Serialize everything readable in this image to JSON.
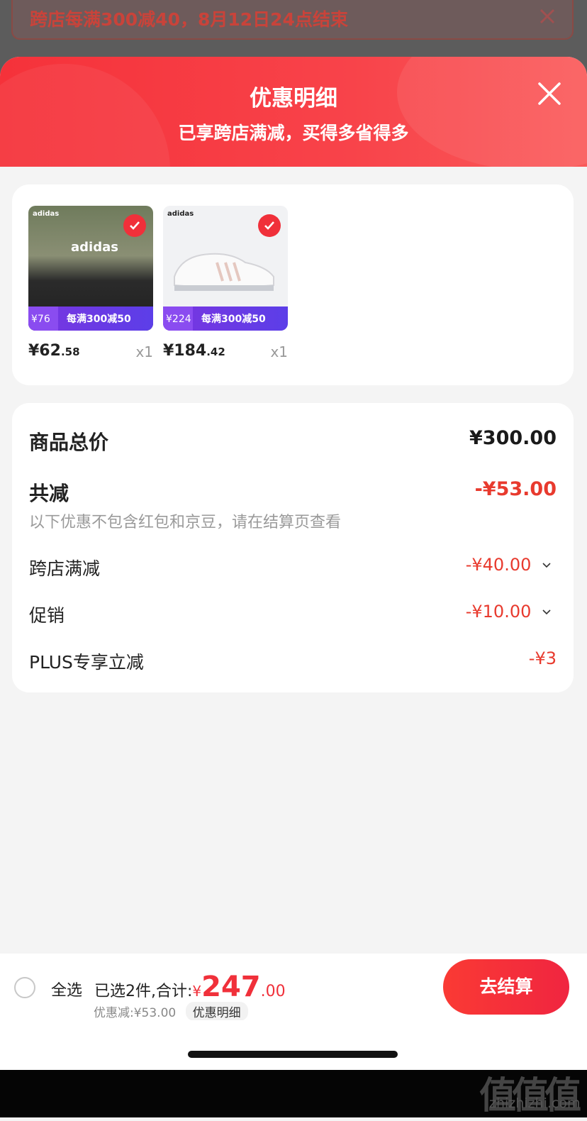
{
  "promo_banner": {
    "text": "跨店每满300减40，8月12日24点结束"
  },
  "sheet": {
    "title": "优惠明细",
    "subtitle": "已享跨店满减，买得多省得多"
  },
  "products": [
    {
      "image_text": "adidas",
      "ribbon_price": "¥76",
      "ribbon_text": "每满300减50",
      "price_int": "¥62",
      "price_dec": ".58",
      "qty": "x1"
    },
    {
      "image_text": "adidas",
      "ribbon_price": "¥224",
      "ribbon_text": "每满300减50",
      "price_int": "¥184",
      "price_dec": ".42",
      "qty": "x1"
    }
  ],
  "summary": {
    "total_label": "商品总价",
    "total_value": "¥300.00",
    "reduce_label": "共减",
    "reduce_value": "-¥53.00",
    "note": "以下优惠不包含红包和京豆，请在结算页查看",
    "items": [
      {
        "label": "跨店满减",
        "value": "-¥40.00"
      },
      {
        "label": "促销",
        "value": "-¥10.00"
      },
      {
        "label": "PLUS专享立减",
        "value": "-¥3"
      }
    ]
  },
  "bottom_bar": {
    "select_all": "全选",
    "selected_text": "已选2件,合计:",
    "total_currency": "¥",
    "total_int": "247",
    "total_dec": ".00",
    "discount_text": "优惠减:¥53.00",
    "detail_link": "优惠明细",
    "checkout": "去结算"
  },
  "watermark": {
    "glyphs": [
      "值",
      "值",
      "值"
    ],
    "url": "zhizhizhi.com"
  },
  "colors": {
    "accent_red": "#f0303a",
    "header_red": "#f5323a",
    "ribbon_purple": "#6a3ae6"
  }
}
